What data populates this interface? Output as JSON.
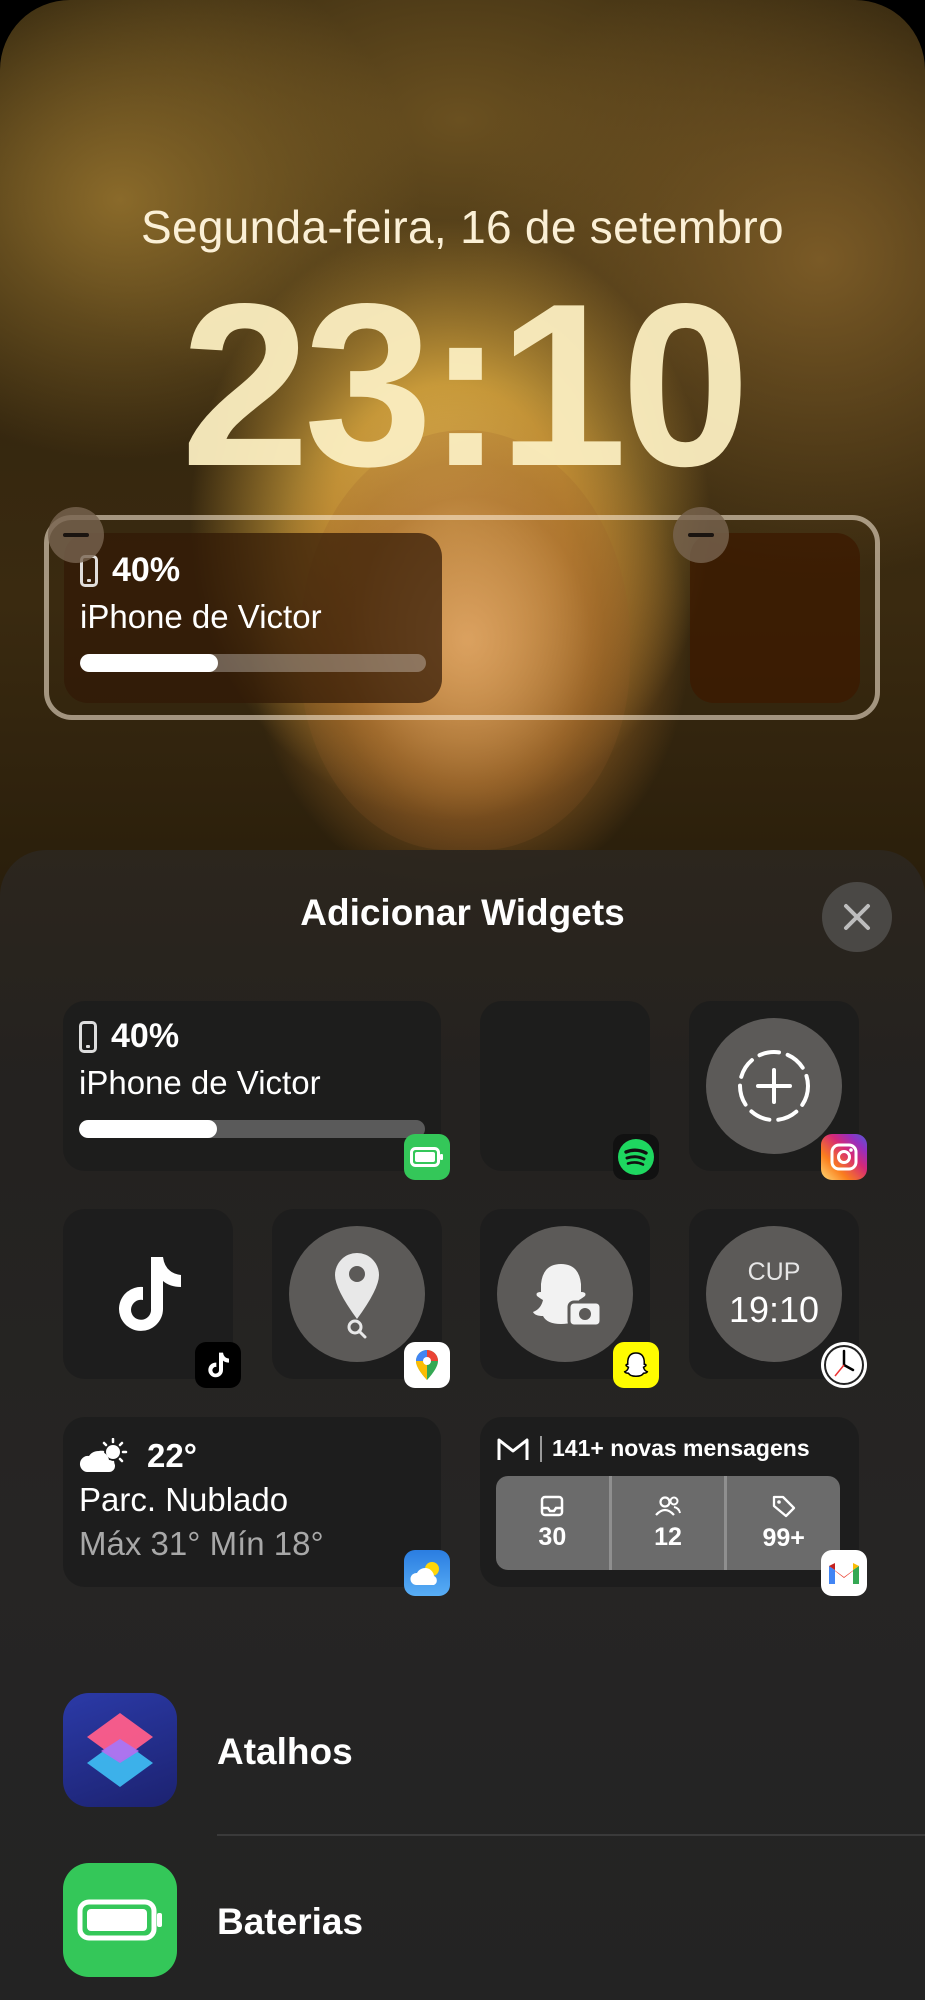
{
  "lock_screen": {
    "date": "Segunda-feira, 16 de setembro",
    "time": "23:10",
    "battery_widget": {
      "percent": "40%",
      "device": "iPhone de Victor",
      "level": 0.4
    }
  },
  "sheet": {
    "title": "Adicionar Widgets",
    "widgets": {
      "battery": {
        "percent": "40%",
        "device": "iPhone de Victor",
        "level": 0.4
      },
      "clock": {
        "city": "CUP",
        "time": "19:10"
      },
      "weather": {
        "temp": "22°",
        "condition": "Parc. Nublado",
        "range": "Máx 31° Mín 18°"
      },
      "gmail": {
        "header": "141+ novas mensagens",
        "counts": [
          {
            "icon": "inbox-icon",
            "value": "30"
          },
          {
            "icon": "people-icon",
            "value": "12"
          },
          {
            "icon": "tag-icon",
            "value": "99+"
          }
        ]
      }
    },
    "apps": [
      {
        "label": "Atalhos",
        "icon": "shortcuts-icon"
      },
      {
        "label": "Baterias",
        "icon": "battery-app-icon"
      }
    ]
  },
  "colors": {
    "accent_green": "#34c759",
    "sheet_bg": "#262524",
    "spotify_green": "#1ed760"
  }
}
